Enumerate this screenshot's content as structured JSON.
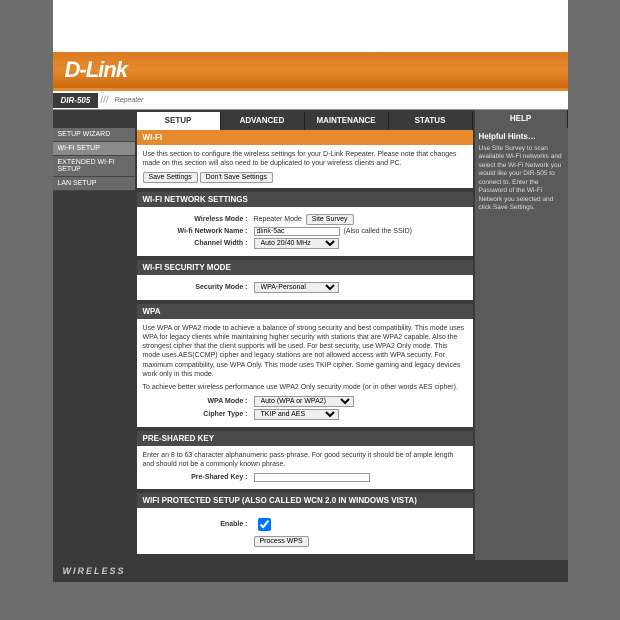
{
  "logo": "D-Link",
  "model": "DIR-505",
  "mode": "Repeater",
  "tabs": {
    "setup": "SETUP",
    "advanced": "ADVANCED",
    "maintenance": "MAINTENANCE",
    "status": "STATUS",
    "help": "HELP"
  },
  "sidebar": {
    "wizard": "SETUP WIZARD",
    "wifi": "WI-FI SETUP",
    "extended": "EXTENDED WI-FI SETUP",
    "lan": "LAN SETUP"
  },
  "hints": {
    "title": "Helpful Hints…",
    "text": "Use Site Survey to scan available Wi-Fi networks and select the Wi-Fi Network you would like your DIR-505 to connect to. Enter the Password of the Wi-Fi Network you selected and click Save Settings."
  },
  "wifi": {
    "title": "WI-FI",
    "desc": "Use this section to configure the wireless settings for your D-Link Repeater. Please note that changes made on this section will also need to be duplicated to your wireless clients and PC.",
    "save": "Save Settings",
    "dontsave": "Don't Save Settings"
  },
  "network": {
    "title": "WI-FI NETWORK SETTINGS",
    "mode_label": "Wireless Mode :",
    "mode_value": "Repeater Mode",
    "sitesurvey": "Site Survey",
    "name_label": "Wi-fi Network Name :",
    "name_value": "dlink-5ac",
    "name_after": "(Also called the SSID)",
    "channel_label": "Channel Width :",
    "channel_value": "Auto 20/40 MHz"
  },
  "security": {
    "title": "WI-FI SECURITY MODE",
    "mode_label": "Security Mode :",
    "mode_value": "WPA-Personal"
  },
  "wpa": {
    "title": "WPA",
    "p1": "Use WPA or WPA2 mode to achieve a balance of strong security and best compatibility. This mode uses WPA for legacy clients while maintaining higher security with stations that are WPA2 capable. Also the strongest cipher that the client supports will be used. For best security, use WPA2 Only mode. This mode uses AES(CCMP) cipher and legacy stations are not allowed access with WPA security. For maximum compatibility, use WPA Only. This mode uses TKIP cipher. Some gaming and legacy devices work only in this mode.",
    "p2": "To achieve better wireless performance use WPA2 Only security mode (or in other words AES cipher).",
    "wpamode_label": "WPA Mode :",
    "wpamode_value": "Auto (WPA or WPA2)",
    "cipher_label": "Cipher Type :",
    "cipher_value": "TKIP and AES"
  },
  "psk": {
    "title": "PRE-SHARED KEY",
    "desc": "Enter an 8 to 63 character alphanumeric pass-phrase. For good security it should be of ample length and should not be a commonly known phrase.",
    "label": "Pre-Shared Key :",
    "value": ""
  },
  "wps": {
    "title": "WIFI PROTECTED SETUP (ALSO CALLED WCN 2.0 IN WINDOWS VISTA)",
    "enable_label": "Enable :",
    "process": "Process WPS"
  },
  "footer": "WIRELESS"
}
